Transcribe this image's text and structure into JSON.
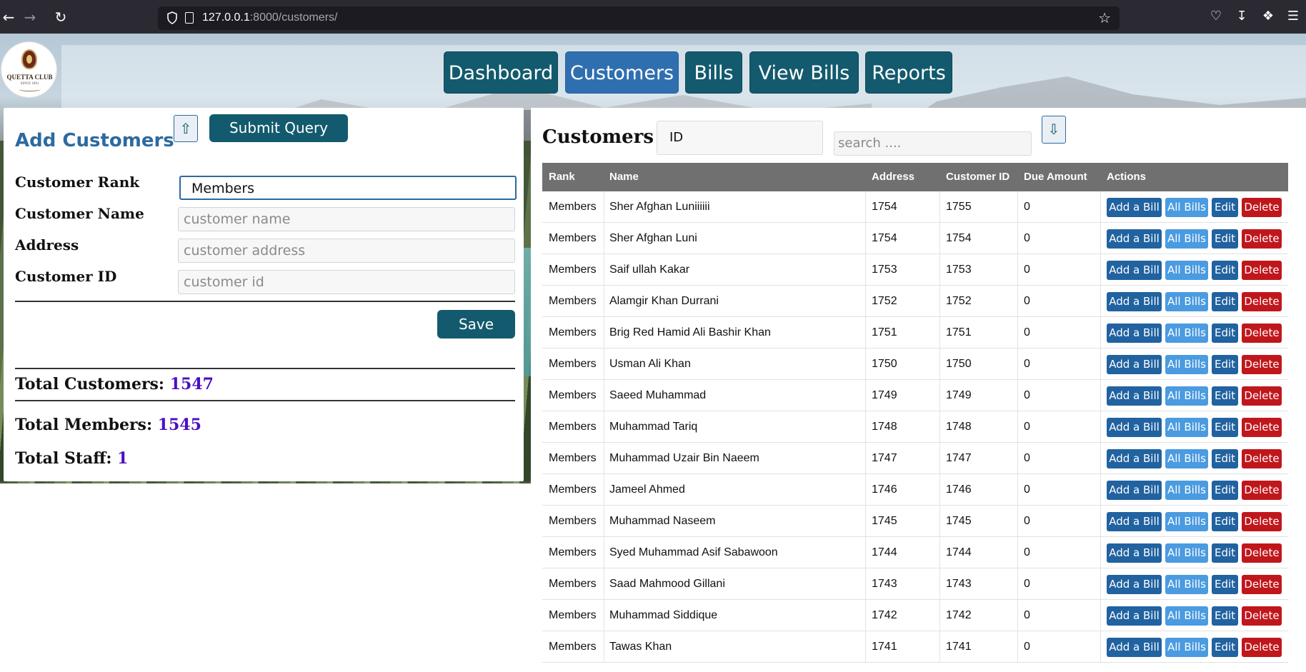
{
  "browser": {
    "url_host": "127.0.0.1",
    "url_rest": ":8000/customers/"
  },
  "logo": {
    "name": "QUETTA CLUB",
    "since": "SINCE 1891"
  },
  "nav": {
    "items": [
      {
        "label": "Dashboard",
        "active": false
      },
      {
        "label": "Customers",
        "active": true
      },
      {
        "label": "Bills",
        "active": false
      },
      {
        "label": "View Bills",
        "active": false
      },
      {
        "label": "Reports",
        "active": false
      }
    ]
  },
  "left": {
    "title": "Add Customers",
    "submit_label": "Submit Query",
    "rank_label": "Customer Rank",
    "rank_value": "Members",
    "name_label": "Customer Name",
    "name_placeholder": "customer name",
    "address_label": "Address",
    "address_placeholder": "customer address",
    "id_label": "Customer ID",
    "id_placeholder": "customer id",
    "save_label": "Save",
    "total_customers_label": "Total Customers:",
    "total_customers": "1547",
    "total_members_label": "Total Members:",
    "total_members": "1545",
    "total_staff_label": "Total Staff:",
    "total_staff": "1"
  },
  "right": {
    "title": "Customers",
    "filter_value": "ID",
    "search_placeholder": "search ....",
    "headers": [
      "Rank",
      "Name",
      "Address",
      "Customer ID",
      "Due Amount",
      "Actions"
    ],
    "actions": {
      "add": "Add a Bill",
      "all": "All Bills",
      "edit": "Edit",
      "delete": "Delete"
    },
    "rows": [
      {
        "rank": "Members",
        "name": "Sher Afghan Luniiiiii",
        "address": "1754",
        "customer_id": "1755",
        "due": "0"
      },
      {
        "rank": "Members",
        "name": "Sher Afghan Luni",
        "address": "1754",
        "customer_id": "1754",
        "due": "0"
      },
      {
        "rank": "Members",
        "name": "Saif ullah Kakar",
        "address": "1753",
        "customer_id": "1753",
        "due": "0"
      },
      {
        "rank": "Members",
        "name": "Alamgir Khan Durrani",
        "address": "1752",
        "customer_id": "1752",
        "due": "0"
      },
      {
        "rank": "Members",
        "name": "Brig Red Hamid Ali Bashir Khan",
        "address": "1751",
        "customer_id": "1751",
        "due": "0"
      },
      {
        "rank": "Members",
        "name": "Usman Ali Khan",
        "address": "1750",
        "customer_id": "1750",
        "due": "0"
      },
      {
        "rank": "Members",
        "name": "Saeed Muhammad",
        "address": "1749",
        "customer_id": "1749",
        "due": "0"
      },
      {
        "rank": "Members",
        "name": "Muhammad Tariq",
        "address": "1748",
        "customer_id": "1748",
        "due": "0"
      },
      {
        "rank": "Members",
        "name": "Muhammad Uzair Bin Naeem",
        "address": "1747",
        "customer_id": "1747",
        "due": "0"
      },
      {
        "rank": "Members",
        "name": "Jameel Ahmed",
        "address": "1746",
        "customer_id": "1746",
        "due": "0"
      },
      {
        "rank": "Members",
        "name": "Muhammad Naseem",
        "address": "1745",
        "customer_id": "1745",
        "due": "0"
      },
      {
        "rank": "Members",
        "name": "Syed Muhammad Asif Sabawoon",
        "address": "1744",
        "customer_id": "1744",
        "due": "0"
      },
      {
        "rank": "Members",
        "name": "Saad Mahmood Gillani",
        "address": "1743",
        "customer_id": "1743",
        "due": "0"
      },
      {
        "rank": "Members",
        "name": "Muhammad Siddique",
        "address": "1742",
        "customer_id": "1742",
        "due": "0"
      },
      {
        "rank": "Members",
        "name": "Tawas Khan",
        "address": "1741",
        "customer_id": "1741",
        "due": "0"
      }
    ]
  },
  "colors": {
    "nav_bg": "#135a6e",
    "nav_active": "#2f6fb0",
    "title_blue": "#2d6aa0",
    "stat_purple": "#4b0fc2",
    "btn_add": "#2162a0",
    "btn_all": "#4a9be0",
    "btn_delete": "#c0171c"
  },
  "icons": [
    "back-icon",
    "forward-icon",
    "reload-icon",
    "shield-icon",
    "page-icon",
    "star-icon",
    "pocket-icon",
    "download-icon",
    "extensions-icon",
    "menu-icon",
    "export-icon",
    "import-icon"
  ]
}
